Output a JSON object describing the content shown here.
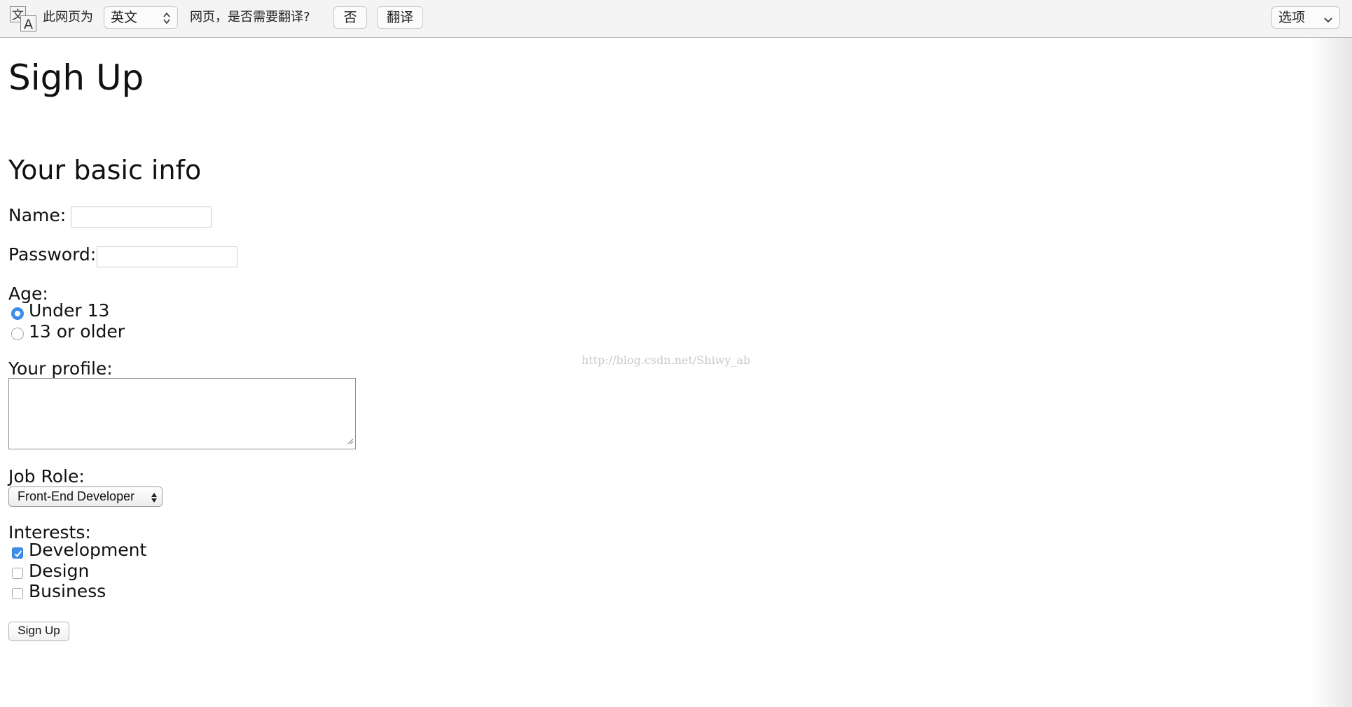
{
  "translate_bar": {
    "prefix": "此网页为",
    "language": "英文",
    "question": "网页，是否需要翻译?",
    "no_label": "否",
    "translate_label": "翻译",
    "options_label": "选项"
  },
  "page": {
    "title": "Sigh Up",
    "section_heading": "Your basic info",
    "name_label": "Name:",
    "name_value": "",
    "password_label": "Password:",
    "password_value": "",
    "age_label": "Age:",
    "age_options": [
      {
        "label": "Under 13",
        "checked": true
      },
      {
        "label": "13 or older",
        "checked": false
      }
    ],
    "profile_label": "Your profile:",
    "profile_value": "",
    "job_role_label": "Job Role:",
    "job_role_selected": "Front-End Developer",
    "interests_label": "Interests:",
    "interests": [
      {
        "label": "Development",
        "checked": true
      },
      {
        "label": "Design",
        "checked": false
      },
      {
        "label": "Business",
        "checked": false
      }
    ],
    "submit_label": "Sign Up",
    "watermark": "http://blog.csdn.net/Shiwy_ab"
  },
  "colors": {
    "accent": "#3d8ee8",
    "bar_background": "#f4f4f4"
  }
}
